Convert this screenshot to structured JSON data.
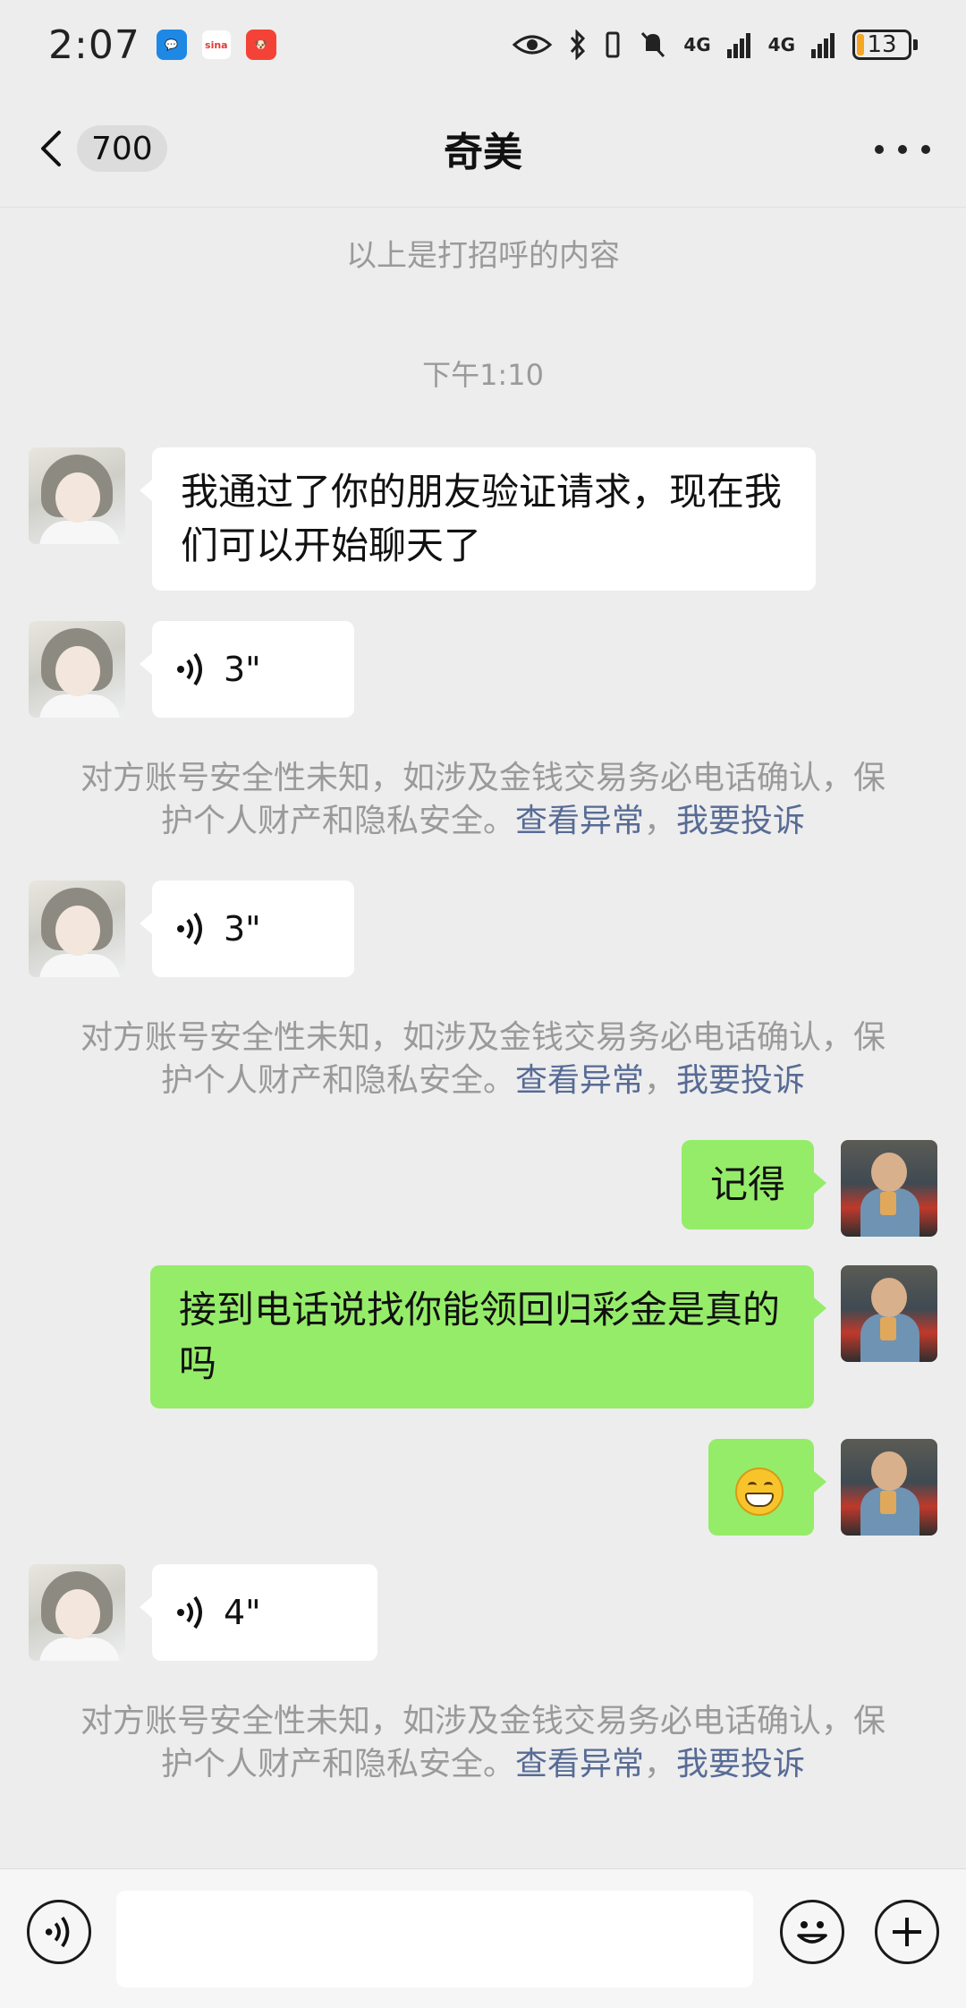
{
  "status_bar": {
    "time": "2:07",
    "app_icons": [
      {
        "name": "message-app-icon",
        "text": "",
        "color": "#1e88e5"
      },
      {
        "name": "sina-app-icon",
        "text": "sina",
        "color": "#e53935"
      },
      {
        "name": "shopping-app-icon",
        "text": "",
        "color": "#f44336"
      }
    ],
    "network": "4G",
    "battery": "13"
  },
  "nav": {
    "unread_count": "700",
    "title": "奇美"
  },
  "chat": {
    "greeting_line": "以上是打招呼的内容",
    "timestamp": "下午1:10",
    "messages": [
      {
        "text": "我通过了你的朋友验证请求，现在我们可以开始聊天了"
      },
      {
        "duration": "3\""
      },
      {
        "duration": "3\""
      },
      {
        "text": "记得"
      },
      {
        "text": "接到电话说找你能领回归彩金是真的吗"
      },
      {
        "emoji": "grinning-face"
      },
      {
        "duration": "4\""
      }
    ],
    "notice": {
      "text": "对方账号安全性未知，如涉及金钱交易务必电话确认，保护个人财产和隐私安全。",
      "link_abnormal": "查看异常",
      "separator": "，",
      "link_complain": "我要投诉"
    }
  },
  "input_bar": {
    "placeholder": ""
  }
}
